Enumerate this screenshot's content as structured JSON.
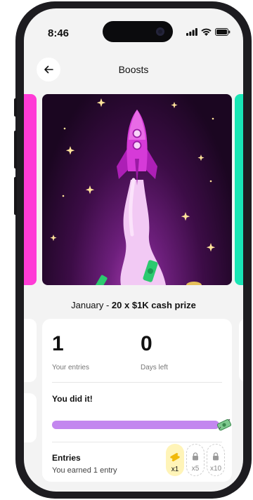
{
  "status_bar": {
    "time": "8:46"
  },
  "header": {
    "title": "Boosts"
  },
  "prize": {
    "month": "January",
    "separator": " - ",
    "description": "20 x $1K cash prize"
  },
  "stats": {
    "entries": {
      "value": "1",
      "label": "Your entries"
    },
    "days_left": {
      "value": "0",
      "label": "Days left"
    }
  },
  "progress": {
    "title": "You did it!",
    "fraction": 1.0
  },
  "entries_section": {
    "title": "Entries",
    "subtitle": "You earned 1 entry",
    "multipliers": [
      {
        "label": "x1",
        "state": "active",
        "icon": "ticket-icon"
      },
      {
        "label": "x5",
        "state": "locked",
        "icon": "lock-icon"
      },
      {
        "label": "x10",
        "state": "locked",
        "icon": "lock-icon"
      }
    ]
  },
  "colors": {
    "accent_purple": "#c387ef",
    "carousel_left": "#ff3bd6",
    "carousel_right": "#19e6b5",
    "rocket": "#d63ad8"
  }
}
